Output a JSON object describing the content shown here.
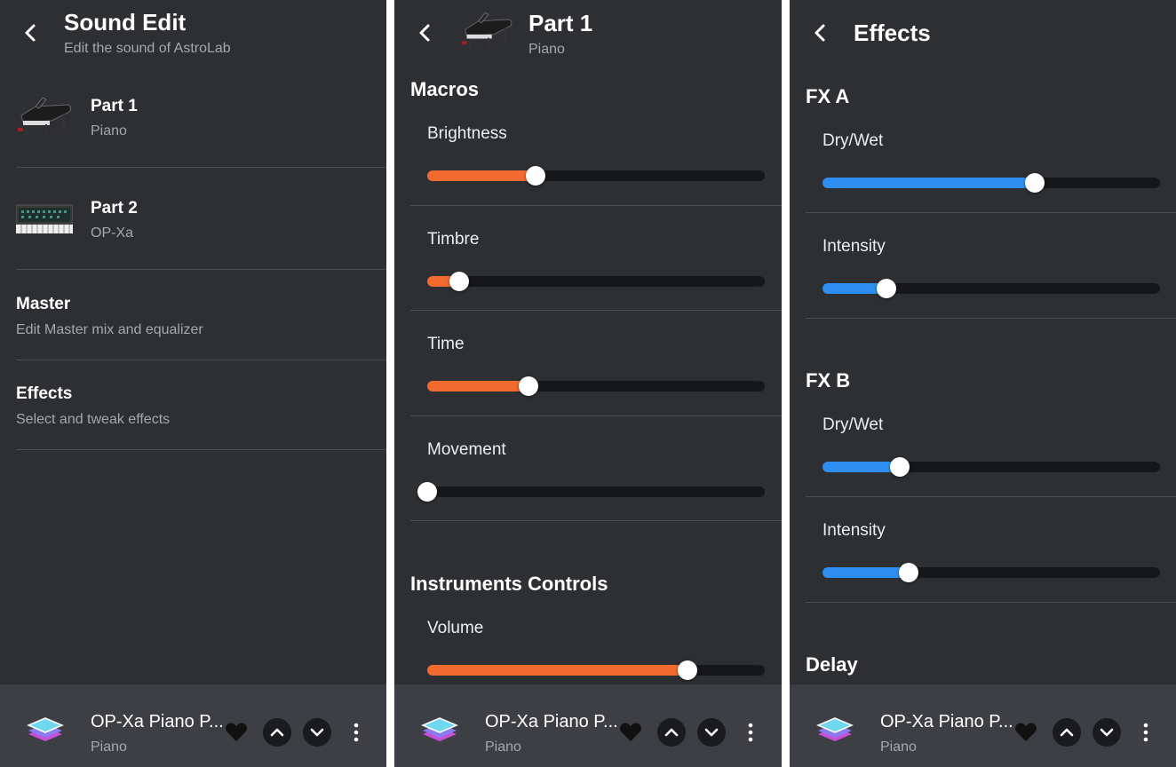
{
  "colors": {
    "panel": "#2d2f33",
    "orange": "#f26a2e",
    "blue": "#2e8ef0",
    "track": "#16171a"
  },
  "sound_edit": {
    "title": "Sound Edit",
    "subtitle": "Edit the sound of AstroLab",
    "items": [
      {
        "title": "Part 1",
        "subtitle": "Piano",
        "icon": "grand-piano-image"
      },
      {
        "title": "Part 2",
        "subtitle": "OP-Xa",
        "icon": "synthesizer-image"
      },
      {
        "title": "Master",
        "subtitle": "Edit Master mix and equalizer"
      },
      {
        "title": "Effects",
        "subtitle": "Select and tweak effects"
      }
    ]
  },
  "part1": {
    "title": "Part 1",
    "subtitle": "Piano",
    "macros_heading": "Macros",
    "macros": [
      {
        "label": "Brightness",
        "value": 0.32
      },
      {
        "label": "Timbre",
        "value": 0.095
      },
      {
        "label": "Time",
        "value": 0.3
      },
      {
        "label": "Movement",
        "value": 0.0
      }
    ],
    "instruments_heading": "Instruments Controls",
    "instruments": [
      {
        "label": "Volume",
        "value": 0.77
      }
    ]
  },
  "effects": {
    "title": "Effects",
    "fx_a": {
      "heading": "FX A",
      "sliders": [
        {
          "label": "Dry/Wet",
          "value": 0.63
        },
        {
          "label": "Intensity",
          "value": 0.19
        }
      ]
    },
    "fx_b": {
      "heading": "FX B",
      "sliders": [
        {
          "label": "Dry/Wet",
          "value": 0.23
        },
        {
          "label": "Intensity",
          "value": 0.255
        }
      ]
    },
    "delay_heading": "Delay"
  },
  "player": {
    "title": "OP-Xa Piano P...",
    "subtitle": "Piano",
    "icons": [
      "layers-icon",
      "heart-icon",
      "chevron-up-icon",
      "chevron-down-icon",
      "more-vertical-icon"
    ]
  }
}
